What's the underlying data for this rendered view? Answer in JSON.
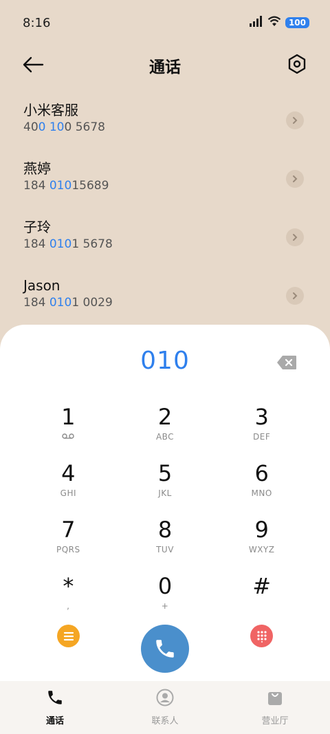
{
  "status_bar": {
    "time": "8:16",
    "battery": "100",
    "icons": [
      "signal-icon",
      "wifi-icon",
      "battery-icon"
    ]
  },
  "header": {
    "title": "通话",
    "back_icon": "back-arrow-icon",
    "settings_icon": "settings-icon"
  },
  "contacts": [
    {
      "name": "小米客服",
      "number_parts": [
        "40",
        "0 10",
        "0 5678"
      ]
    },
    {
      "name": "燕婷",
      "number_parts": [
        "184 ",
        "010",
        "15689"
      ]
    },
    {
      "name": "子玲",
      "number_parts": [
        "184 ",
        "010",
        "1 5678"
      ]
    },
    {
      "name": "Jason",
      "number_parts": [
        "184 ",
        "010",
        "1 0029"
      ]
    }
  ],
  "dialer": {
    "input_value": "010",
    "keys": [
      {
        "digit": "1",
        "letters": ""
      },
      {
        "digit": "2",
        "letters": "ABC"
      },
      {
        "digit": "3",
        "letters": "DEF"
      },
      {
        "digit": "4",
        "letters": "GHI"
      },
      {
        "digit": "5",
        "letters": "JKL"
      },
      {
        "digit": "6",
        "letters": "MNO"
      },
      {
        "digit": "7",
        "letters": "PQRS"
      },
      {
        "digit": "8",
        "letters": "TUV"
      },
      {
        "digit": "9",
        "letters": "WXYZ"
      },
      {
        "digit": "*",
        "letters": ","
      },
      {
        "digit": "0",
        "letters": "+"
      },
      {
        "digit": "#",
        "letters": ""
      }
    ]
  },
  "bottom_nav": {
    "items": [
      {
        "label": "通话",
        "icon": "phone-icon",
        "active": true
      },
      {
        "label": "联系人",
        "icon": "contacts-icon",
        "active": false
      },
      {
        "label": "营业厅",
        "icon": "shopping-bag-icon",
        "active": false
      }
    ]
  },
  "colors": {
    "background": "#e7d9ca",
    "accent": "#2f80ed",
    "call_button": "#4a8fcc",
    "menu_button": "#f5a623",
    "keypad_button": "#f06464"
  }
}
